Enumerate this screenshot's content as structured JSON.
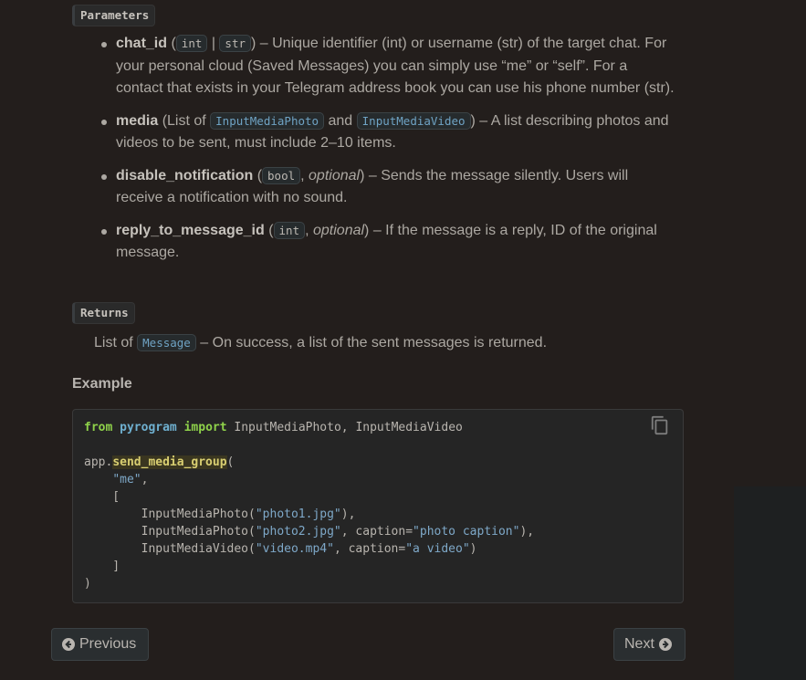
{
  "sections": {
    "parameters_label": "Parameters",
    "returns_label": "Returns",
    "example_label": "Example"
  },
  "params": [
    {
      "name": "chat_id",
      "open": " (",
      "type1": "int",
      "sep": " | ",
      "type2": "str",
      "desc": ") – Unique identifier (int) or username (str) of the target chat. For your personal cloud (Saved Messages) you can simply use “me” or “self”. For a contact that exists in your Telegram address book you can use his phone number (str)."
    },
    {
      "name": "media",
      "open": " (List of ",
      "type1": "InputMediaPhoto",
      "sep": " and ",
      "type2": "InputMediaVideo",
      "desc": ") – A list describing photos and videos to be sent, must include 2–10 items."
    },
    {
      "name": "disable_notification",
      "open": " (",
      "type1": "bool",
      "optional": "optional",
      "desc": ") – Sends the message silently. Users will receive a notification with no sound."
    },
    {
      "name": "reply_to_message_id",
      "open": " (",
      "type1": "int",
      "optional": "optional",
      "desc": ") – If the message is a reply, ID of the original message."
    }
  ],
  "returns": {
    "prefix": "List of ",
    "type": "Message",
    "desc": " – On success, a list of the sent messages is returned."
  },
  "code": {
    "line1": {
      "kw_from": "from",
      "module": "pyrogram",
      "kw_import": "import",
      "rest": " InputMediaPhoto, InputMediaVideo"
    },
    "line3": {
      "obj": "app.",
      "fn": "send_media_group",
      "open": "("
    },
    "line4": {
      "indent": "    ",
      "str": "\"me\"",
      "tail": ","
    },
    "line5": "    [",
    "line6": {
      "pre": "        InputMediaPhoto(",
      "str": "\"photo1.jpg\"",
      "tail": "),"
    },
    "line7": {
      "pre": "        InputMediaPhoto(",
      "str": "\"photo2.jpg\"",
      "mid": ", caption=",
      "str2": "\"photo caption\"",
      "tail": "),"
    },
    "line8": {
      "pre": "        InputMediaVideo(",
      "str": "\"video.mp4\"",
      "mid": ", caption=",
      "str2": "\"a video\"",
      "tail": ")"
    },
    "line9": "    ]",
    "line10": ")"
  },
  "nav": {
    "previous_label": "Previous",
    "next_label": "Next"
  },
  "icons": {
    "copy": "copy-icon",
    "previous": "arrow-circle-left-icon",
    "next": "arrow-circle-right-icon"
  }
}
